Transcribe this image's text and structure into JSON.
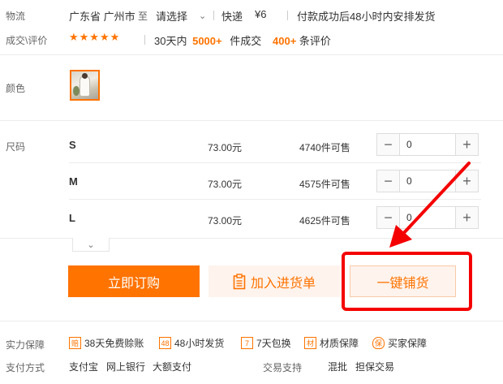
{
  "logistics": {
    "label": "物流",
    "origin": "广东省 广州市",
    "to": "至",
    "destination": "请选择",
    "express": "快递",
    "fee": "¥6",
    "shipping_note": "付款成功后48小时内安排发货"
  },
  "deals": {
    "label": "成交\\评价",
    "stars": "★★★★★",
    "days": "30天内",
    "count": "5000+",
    "count_suffix": "件成交",
    "reviews": "400+",
    "reviews_suffix": "条评价"
  },
  "color": {
    "label": "颜色"
  },
  "size": {
    "label": "尺码",
    "rows": [
      {
        "size": "S",
        "price": "73.00元",
        "stock": "4740件可售",
        "qty": "0"
      },
      {
        "size": "M",
        "price": "73.00元",
        "stock": "4575件可售",
        "qty": "0"
      },
      {
        "size": "L",
        "price": "73.00元",
        "stock": "4625件可售",
        "qty": "0"
      }
    ],
    "collapse_icon": "chevron-down-icon"
  },
  "actions": {
    "buy": "立即订购",
    "cart": "加入进货单",
    "distribute": "一键铺货"
  },
  "guarantee": {
    "label": "实力保障",
    "items": [
      {
        "icon": "赔",
        "text": "38天免费赊账"
      },
      {
        "icon": "48",
        "text": "48小时发货"
      },
      {
        "icon": "7",
        "text": "7天包换"
      },
      {
        "icon": "材",
        "text": "材质保障"
      },
      {
        "icon": "保",
        "text": "买家保障"
      }
    ]
  },
  "payment": {
    "label": "支付方式",
    "methods": [
      "支付宝",
      "网上银行",
      "大额支付"
    ],
    "trade_label": "交易支持",
    "trade_methods": [
      "混批",
      "担保交易"
    ]
  },
  "colors": {
    "accent": "#ff7300",
    "annotation": "#f40000"
  }
}
